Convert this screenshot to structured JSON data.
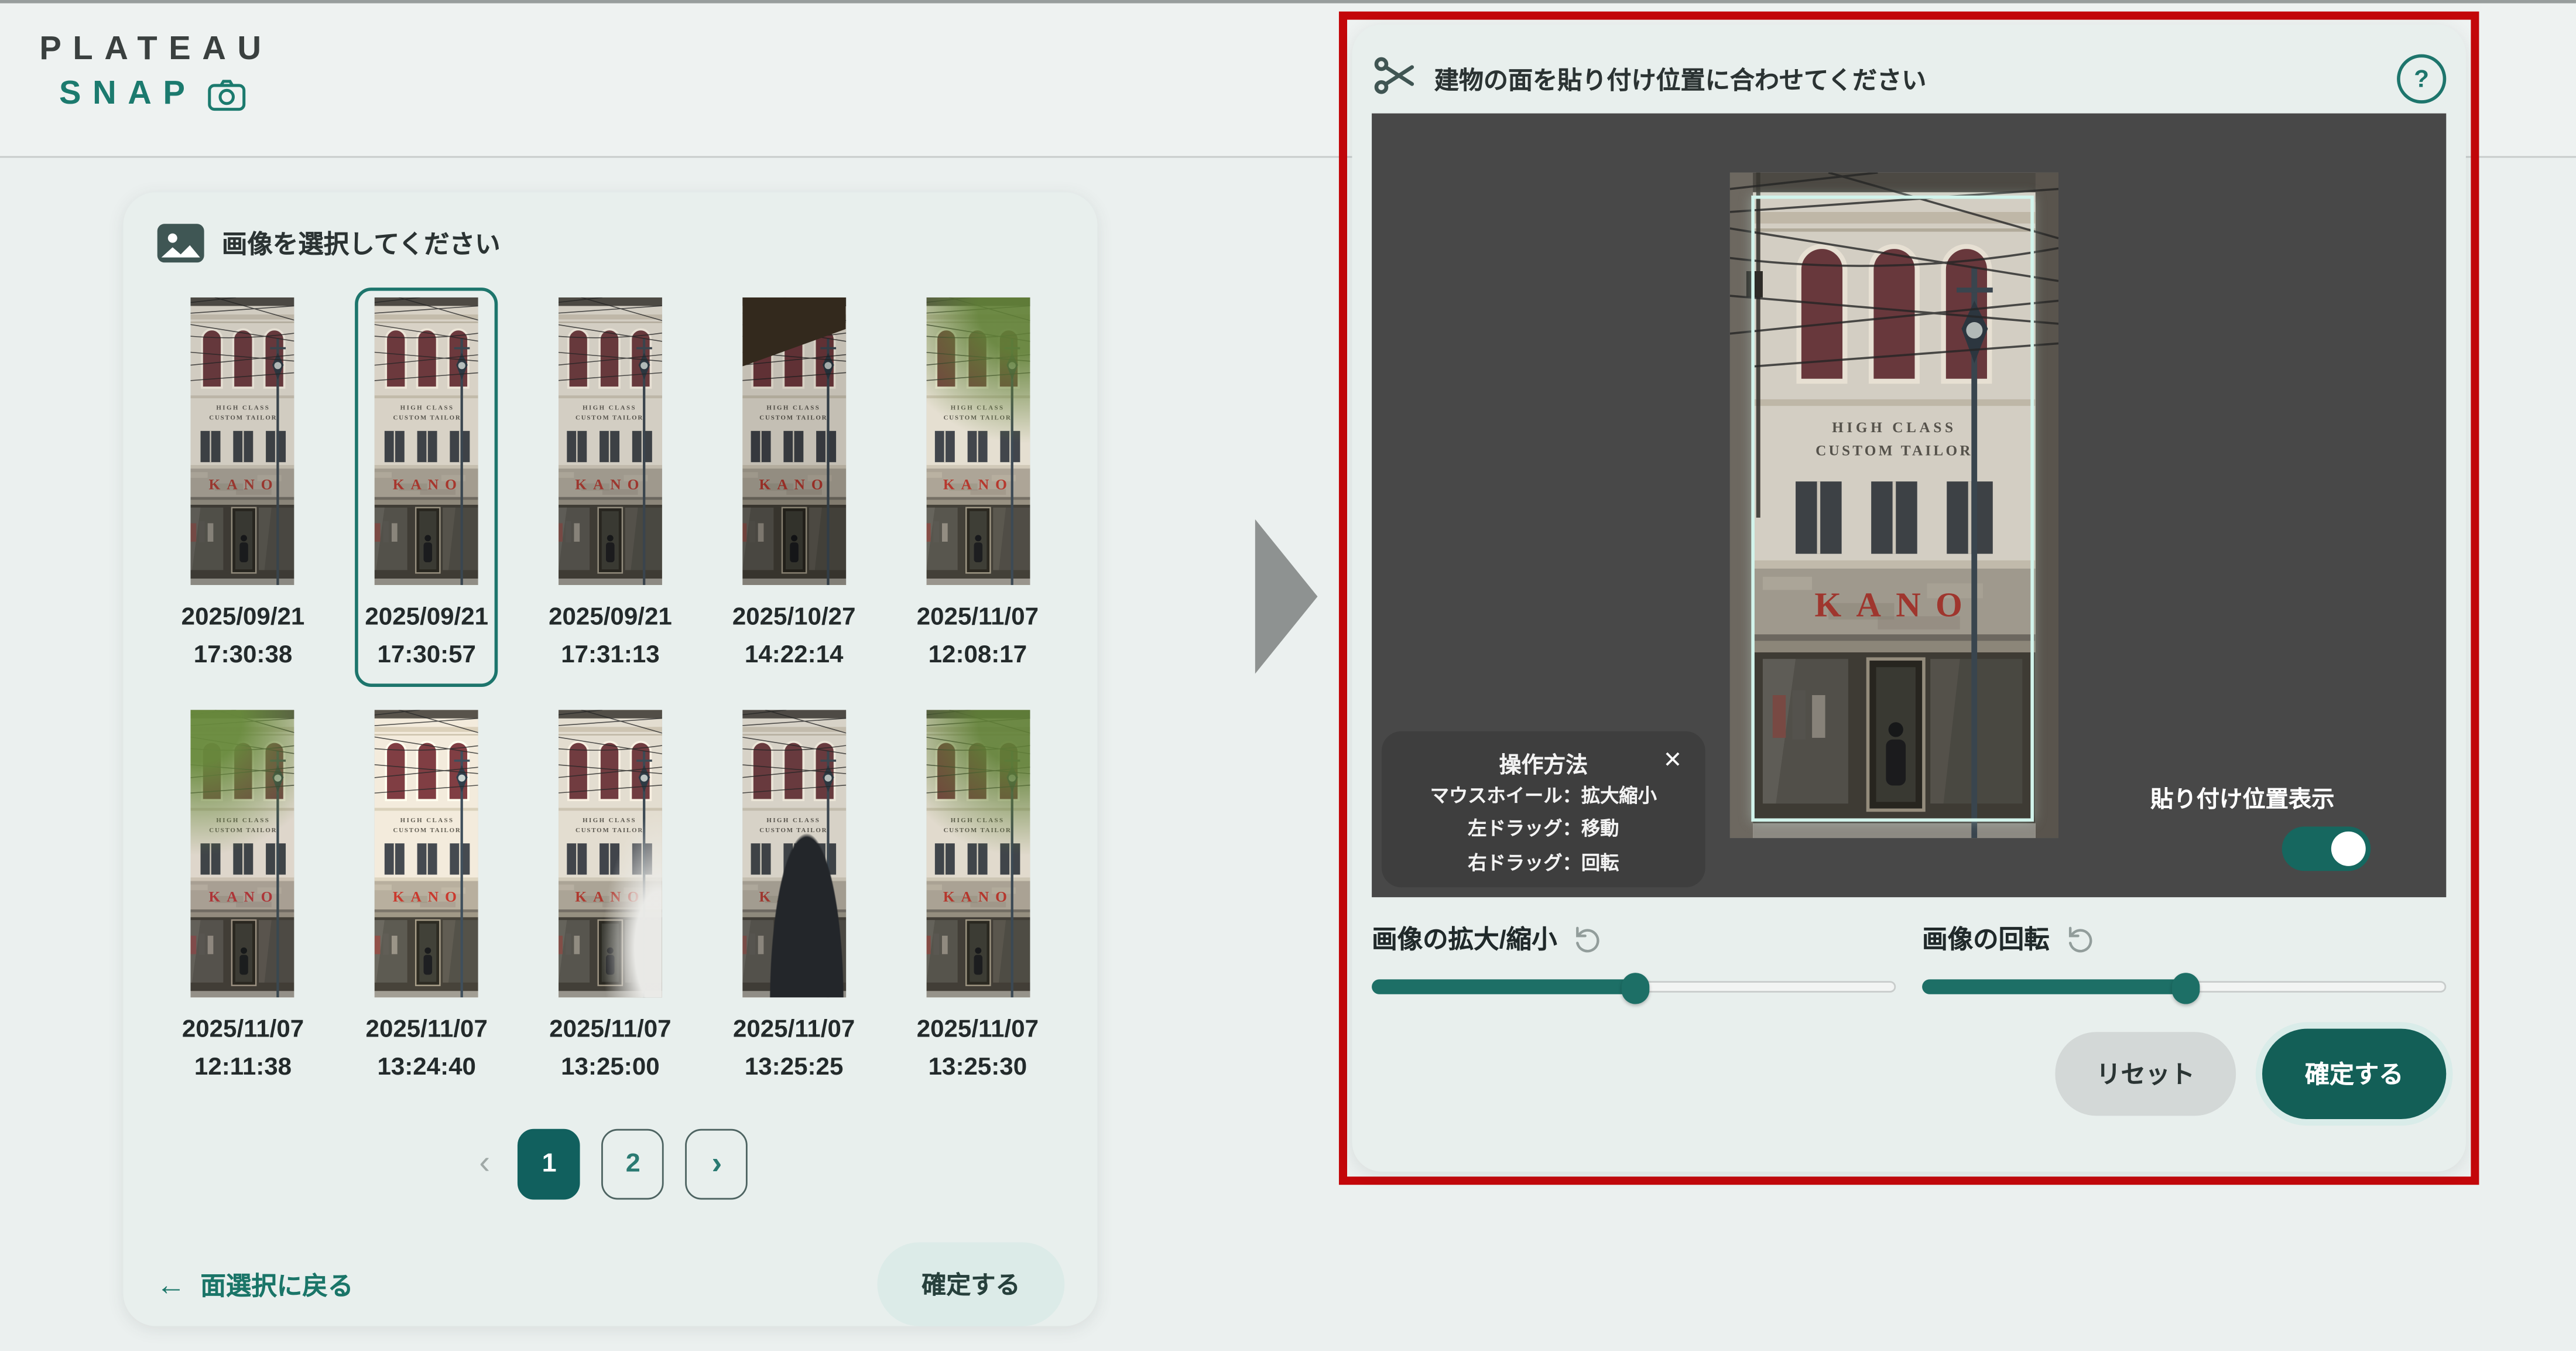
{
  "header": {
    "brand_top": "PLATEAU",
    "brand_bottom": "SNAP"
  },
  "left_panel": {
    "title": "画像を選択してください",
    "thumbnails": [
      {
        "date": "2025/09/21",
        "time": "17:30:38",
        "selected": false,
        "overlay": ""
      },
      {
        "date": "2025/09/21",
        "time": "17:30:57",
        "selected": true,
        "overlay": ""
      },
      {
        "date": "2025/09/21",
        "time": "17:31:13",
        "selected": false,
        "overlay": ""
      },
      {
        "date": "2025/10/27",
        "time": "14:22:14",
        "selected": false,
        "overlay": "awning"
      },
      {
        "date": "2025/11/07",
        "time": "12:08:17",
        "selected": false,
        "overlay": "leaves-tr"
      },
      {
        "date": "2025/11/07",
        "time": "12:11:38",
        "selected": false,
        "overlay": "leaves-tl"
      },
      {
        "date": "2025/11/07",
        "time": "13:24:40",
        "selected": false,
        "overlay": ""
      },
      {
        "date": "2025/11/07",
        "time": "13:25:00",
        "selected": false,
        "overlay": "car"
      },
      {
        "date": "2025/11/07",
        "time": "13:25:25",
        "selected": false,
        "overlay": "person"
      },
      {
        "date": "2025/11/07",
        "time": "13:25:30",
        "selected": false,
        "overlay": "leaves-tr"
      }
    ],
    "pagination": {
      "prev": "‹",
      "pages": [
        {
          "label": "1",
          "active": true
        },
        {
          "label": "2",
          "active": false
        }
      ],
      "next": "›"
    },
    "back_arrow": "←",
    "back_link": "面選択に戻る",
    "confirm_label": "確定する"
  },
  "right_panel": {
    "title": "建物の面を貼り付け位置に合わせてください",
    "help_label": "?",
    "tooltip": {
      "title": "操作方法",
      "close": "✕",
      "lines": [
        "マウスホイール：拡大縮小",
        "左ドラッグ：移動",
        "右ドラッグ：回転"
      ]
    },
    "toggle_label": "貼り付け位置表示",
    "toggle_on": true,
    "sliders": [
      {
        "label": "画像の拡大/縮小",
        "value": 50
      },
      {
        "label": "画像の回転",
        "value": 50
      }
    ],
    "reset_label": "リセット",
    "confirm_label": "確定する",
    "building": {
      "sign_line1": "HIGH CLASS",
      "sign_line2": "CUSTOM TAILOR",
      "sign_main": "KANO"
    }
  },
  "colors": {
    "accent_teal": "#176b62",
    "annotation_red": "#c3070a",
    "canvas_gray": "#484848",
    "paste_rect_cyan": "#d2f4ec"
  }
}
